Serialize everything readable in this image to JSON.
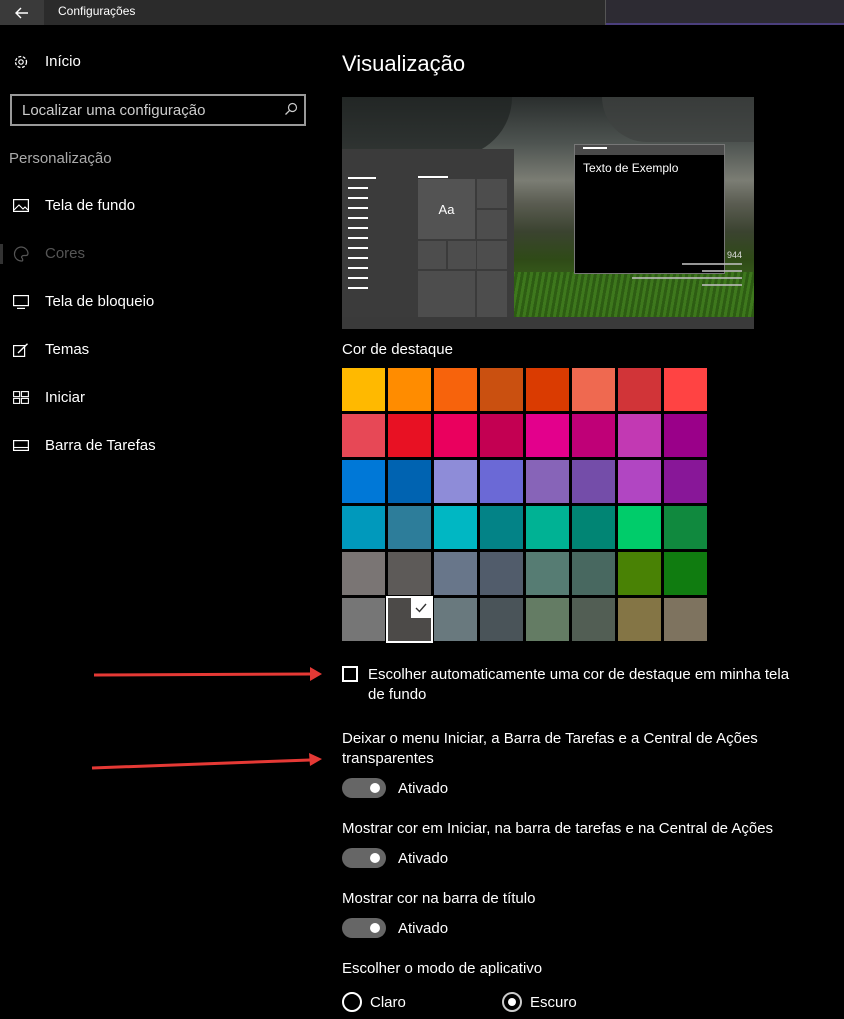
{
  "window": {
    "title": "Configurações"
  },
  "sidebar": {
    "home_label": "Início",
    "search_placeholder": "Localizar uma configuração",
    "section": "Personalização",
    "items": [
      {
        "label": "Tela de fundo",
        "icon": "picture-icon",
        "active": false
      },
      {
        "label": "Cores",
        "icon": "palette-icon",
        "active": true
      },
      {
        "label": "Tela de bloqueio",
        "icon": "lock-screen-icon",
        "active": false
      },
      {
        "label": "Temas",
        "icon": "themes-icon",
        "active": false
      },
      {
        "label": "Iniciar",
        "icon": "start-icon",
        "active": false
      },
      {
        "label": "Barra de Tarefas",
        "icon": "taskbar-icon",
        "active": false
      }
    ]
  },
  "main": {
    "title": "Visualização",
    "preview": {
      "tile_text": "Aa",
      "sample_text": "Texto de Exemplo",
      "corner_number": "944"
    },
    "accent": {
      "label": "Cor de destaque",
      "selected": "#4c4a48",
      "colors": [
        "#ffb900",
        "#ff8c00",
        "#f7630c",
        "#ca5010",
        "#da3b01",
        "#ef6950",
        "#d13438",
        "#ff4343",
        "#e74856",
        "#e81123",
        "#ea005e",
        "#c30052",
        "#e3008c",
        "#bf0077",
        "#c239b3",
        "#9a0089",
        "#0078d7",
        "#0063b1",
        "#8e8cd8",
        "#6b69d6",
        "#8764b8",
        "#744da9",
        "#b146c2",
        "#881798",
        "#0099bc",
        "#2d7d9a",
        "#00b7c3",
        "#038387",
        "#00b294",
        "#018574",
        "#00cc6a",
        "#10893e",
        "#7a7574",
        "#5d5a58",
        "#68768a",
        "#515c6b",
        "#567c73",
        "#486860",
        "#498205",
        "#107c10",
        "#767676",
        "#4c4a48",
        "#69797e",
        "#4a5459",
        "#647c64",
        "#525e54",
        "#847545",
        "#7e735f"
      ]
    },
    "auto_accent": {
      "label": "Escolher automaticamente uma cor de destaque em minha tela de fundo",
      "checked": false
    },
    "transparency": {
      "label": "Deixar o menu Iniciar, a Barra de Tarefas e a Central de Ações transparentes",
      "state": "Ativado"
    },
    "show_color_start": {
      "label": "Mostrar cor em Iniciar, na barra de tarefas e na Central de Ações",
      "state": "Ativado"
    },
    "show_color_title": {
      "label": "Mostrar cor na barra de título",
      "state": "Ativado"
    },
    "app_mode": {
      "label": "Escolher o modo de aplicativo",
      "options": [
        "Claro",
        "Escuro"
      ],
      "selected": "Escuro"
    }
  },
  "annotation_color": "#e53935"
}
